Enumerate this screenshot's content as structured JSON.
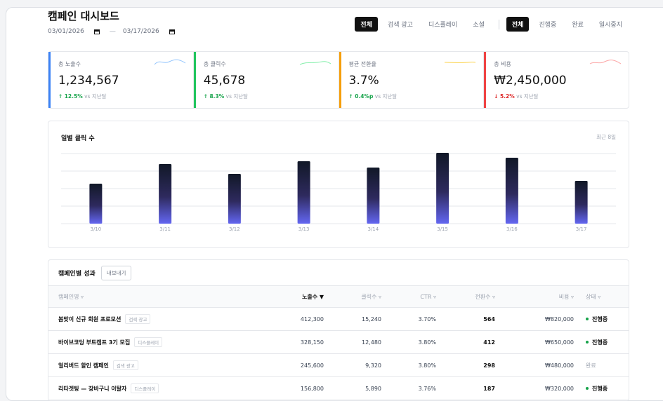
{
  "header": {
    "title": "캠페인 대시보드",
    "start_date": "03/01/2026",
    "end_date": "03/17/2026",
    "date_sep": "—"
  },
  "filters": {
    "channel": [
      "전체",
      "검색 광고",
      "디스플레이",
      "소셜"
    ],
    "status": [
      "전체",
      "진행중",
      "완료",
      "일시중지"
    ]
  },
  "kpis": [
    {
      "label": "총 노출수",
      "value": "1,234,567",
      "arrow": "↑",
      "delta": "12.5%",
      "suffix": "vs 지난달",
      "color": "#3b82f6",
      "trend": "up"
    },
    {
      "label": "총 클릭수",
      "value": "45,678",
      "arrow": "↑",
      "delta": "8.3%",
      "suffix": "vs 지난달",
      "color": "#22c55e",
      "trend": "up"
    },
    {
      "label": "평균 전환율",
      "value": "3.7%",
      "arrow": "↑",
      "delta": "0.4%p",
      "suffix": "vs 지난달",
      "color": "#f59e0b",
      "trend": "up"
    },
    {
      "label": "총 비용",
      "value": "₩2,450,000",
      "arrow": "↓",
      "delta": "5.2%",
      "suffix": "vs 지난달",
      "color": "#ef4444",
      "trend": "down"
    }
  ],
  "chart": {
    "title": "일별 클릭 수",
    "subtitle": "최근 8일"
  },
  "chart_data": {
    "type": "bar",
    "title": "일별 클릭 수",
    "categories": [
      "3/10",
      "3/11",
      "3/12",
      "3/13",
      "3/14",
      "3/15",
      "3/16",
      "3/17"
    ],
    "values": [
      57,
      85,
      71,
      89,
      80,
      101,
      94,
      61
    ],
    "ylim": [
      0,
      100
    ],
    "grid": true
  },
  "table": {
    "title": "캠페인별 성과",
    "export_label": "내보내기",
    "columns": [
      "캠페인명 ▿",
      "노출수 ▼",
      "클릭수 ▿",
      "CTR ▿",
      "전환수 ▿",
      "비용 ▿",
      "상태 ▿"
    ],
    "rows": [
      {
        "name": "봄맞이 신규 회원 프로모션",
        "tag": "검색 광고",
        "impressions": "412,300",
        "clicks": "15,240",
        "ctr": "3.70%",
        "conversions": "564",
        "cost": "₩820,000",
        "status": "진행중",
        "active": true
      },
      {
        "name": "바이브코딩 부트캠프 3기 모집",
        "tag": "디스플레이",
        "impressions": "328,150",
        "clicks": "12,480",
        "ctr": "3.80%",
        "conversions": "412",
        "cost": "₩650,000",
        "status": "진행중",
        "active": true
      },
      {
        "name": "얼리버드 할인 캠페인",
        "tag": "검색 광고",
        "impressions": "245,600",
        "clicks": "9,320",
        "ctr": "3.80%",
        "conversions": "298",
        "cost": "₩480,000",
        "status": "완료",
        "active": false
      },
      {
        "name": "리타겟팅 — 장바구니 이탈자",
        "tag": "디스플레이",
        "impressions": "156,800",
        "clicks": "5,890",
        "ctr": "3.76%",
        "conversions": "187",
        "cost": "₩320,000",
        "status": "진행중",
        "active": true
      }
    ]
  }
}
